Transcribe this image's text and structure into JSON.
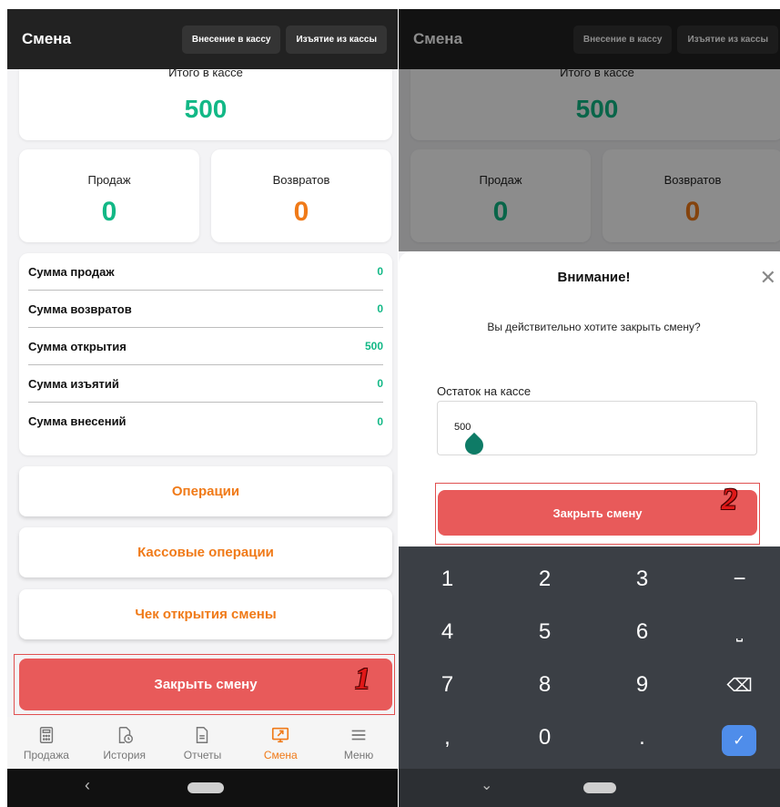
{
  "header": {
    "title": "Смена",
    "deposit_label": "Внесение в кассу",
    "withdraw_label": "Изъятие из кассы"
  },
  "totals": {
    "cash_label": "Итого в кассе",
    "cash_value": "500",
    "sales_label": "Продаж",
    "sales_value": "0",
    "returns_label": "Возвратов",
    "returns_value": "0"
  },
  "sums": [
    {
      "label": "Сумма продаж",
      "value": "0"
    },
    {
      "label": "Сумма возвратов",
      "value": "0"
    },
    {
      "label": "Сумма открытия",
      "value": "500"
    },
    {
      "label": "Сумма изъятий",
      "value": "0"
    },
    {
      "label": "Сумма внесений",
      "value": "0"
    }
  ],
  "actions": {
    "operations": "Операции",
    "cash_operations": "Кассовые операции",
    "opening_receipt": "Чек открытия смены",
    "close_shift": "Закрыть смену"
  },
  "markers": {
    "step1": "1",
    "step2": "2"
  },
  "nav": [
    {
      "label": "Продажа",
      "icon": "calculator-icon"
    },
    {
      "label": "История",
      "icon": "history-icon"
    },
    {
      "label": "Отчеты",
      "icon": "report-icon"
    },
    {
      "label": "Смена",
      "icon": "shift-icon",
      "active": true
    },
    {
      "label": "Меню",
      "icon": "menu-icon"
    }
  ],
  "system": {
    "back_glyph": "‹",
    "down_glyph": "⌄"
  },
  "modal": {
    "title": "Внимание!",
    "close_glyph": "✕",
    "message": "Вы действительно хотите закрыть смену?",
    "field_label": "Остаток на кассе",
    "field_value": "500",
    "confirm_label": "Закрыть смену"
  },
  "keyboard": {
    "keys": [
      "1",
      "2",
      "3",
      "−",
      "4",
      "5",
      "6",
      "⎵",
      "7",
      "8",
      "9",
      "⌫",
      ",",
      "0",
      "."
    ],
    "enter_glyph": "✓"
  },
  "colors": {
    "accent_orange": "#f07a18",
    "positive_green": "#12b886",
    "danger_red": "#e85a5a",
    "returns_orange": "#f07a18",
    "enter_blue": "#4f8dea"
  }
}
